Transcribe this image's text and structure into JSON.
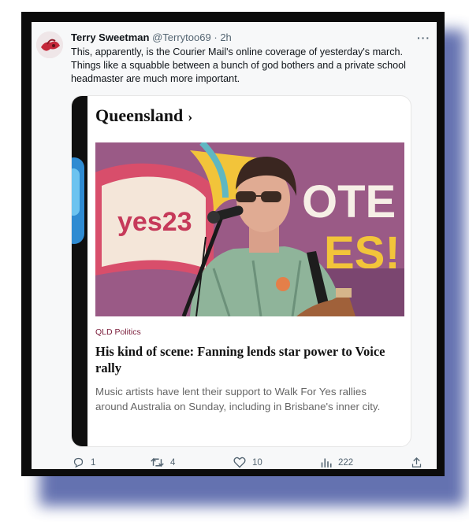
{
  "tweet": {
    "author_name": "Terry Sweetman",
    "handle": "@Terrytoo69",
    "separator": "·",
    "time": "2h",
    "more_label": "···",
    "text": "This, apparently, is the Courier Mail's online coverage of yesterday's march. Things like a squabble between a bunch of god bothers and a private school headmaster are much more important."
  },
  "card": {
    "section": "Queensland",
    "section_chevron": "›",
    "tag": "QLD Politics",
    "headline": "His kind of scene: Fanning lends star power to Voice rally",
    "description": "Music artists have lent their support to Walk For Yes rallies around Australia on Sunday, including in Brisbane's inner city.",
    "photo": {
      "sign_text": "yes23",
      "banner_text": "OTE",
      "banner_text_2": "ES!"
    }
  },
  "actions": {
    "replies": "1",
    "retweets": "4",
    "likes": "10",
    "views": "222"
  },
  "colors": {
    "frame": "#0b0b0b",
    "shadow": "#4a5aa3",
    "tag": "#7a1c3a",
    "muted": "#536471"
  }
}
